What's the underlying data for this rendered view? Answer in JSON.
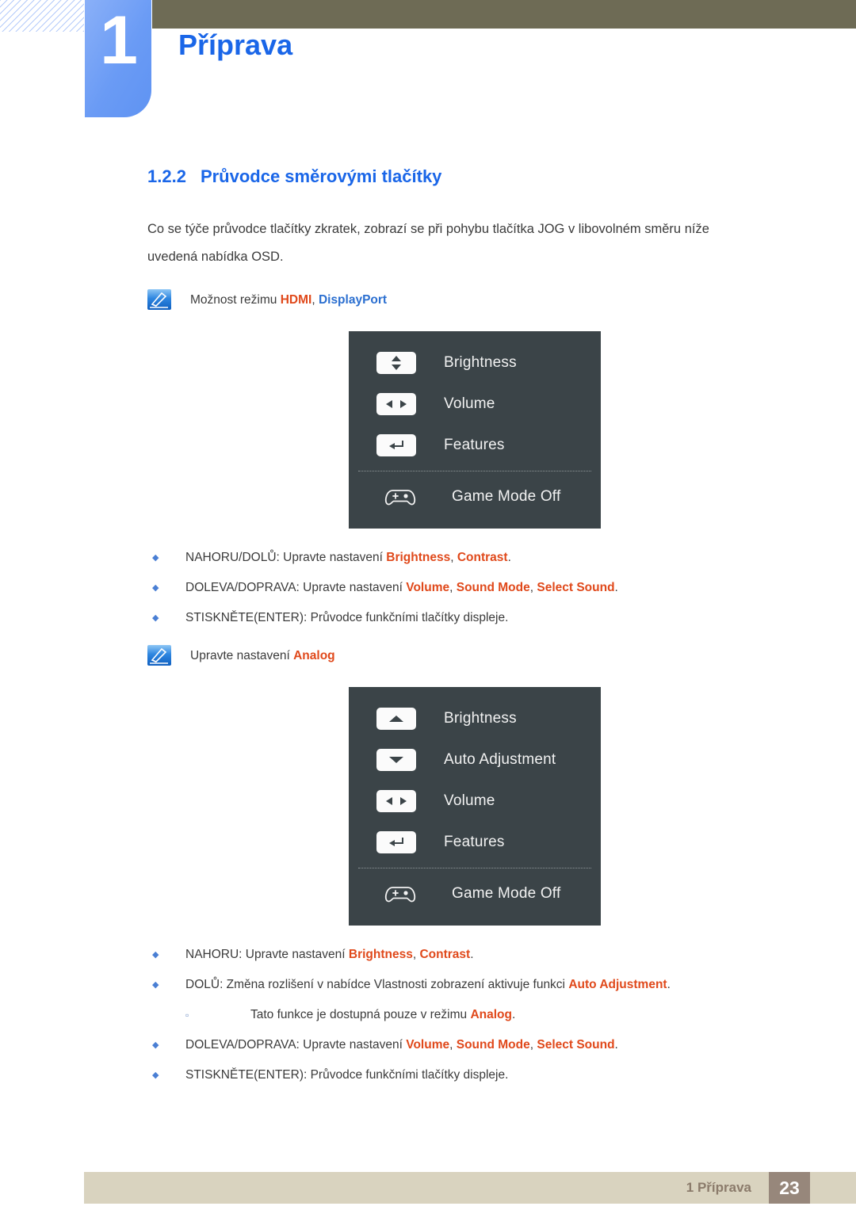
{
  "header": {
    "chapter_number": "1",
    "chapter_title": "Příprava",
    "accent_blue": "#1a66e8",
    "tab_blue": "#6a9bf5",
    "olive": "#6e6b55"
  },
  "section": {
    "number": "1.2.2",
    "title": "Průvodce směrovými tlačítky"
  },
  "intro": {
    "paragraph": "Co se týče průvodce tlačítky zkratek, zobrazí se při pohybu tlačítka JOG v libovolném směru níže uvedená nabídka OSD."
  },
  "note_one": {
    "icon": "note-pen-icon",
    "prefix": "Možnost režimu ",
    "term_hdmi": "HDMI",
    "comma": ", ",
    "term_displayport": "DisplayPort"
  },
  "osd_panel_one": {
    "background": "#3b4448",
    "rows": [
      {
        "key": "updown-arrows-icon",
        "label": "Brightness"
      },
      {
        "key": "leftright-arrows-icon",
        "label": "Volume"
      },
      {
        "key": "enter-arrow-icon",
        "label": "Features"
      }
    ],
    "game_row": {
      "key": "gamepad-icon",
      "label": "Game Mode Off"
    }
  },
  "bullets_one": [
    {
      "prefix": "NAHORU/DOLŮ: Upravte nastavení ",
      "terms": [
        "Brightness",
        "Contrast"
      ],
      "suffix": "."
    },
    {
      "prefix": "DOLEVA/DOPRAVA: Upravte nastavení ",
      "terms": [
        "Volume",
        "Sound Mode",
        "Select Sound"
      ],
      "suffix": "."
    },
    {
      "prefix": "STISKNĚTE(ENTER): Průvodce funkčními tlačítky displeje.",
      "terms": [],
      "suffix": ""
    }
  ],
  "note_two": {
    "icon": "note-pen-icon",
    "prefix": "Upravte nastavení ",
    "term_analog": "Analog"
  },
  "osd_panel_two": {
    "background": "#3b4448",
    "rows": [
      {
        "key": "up-arrow-icon",
        "label": "Brightness"
      },
      {
        "key": "down-arrow-icon",
        "label": "Auto Adjustment"
      },
      {
        "key": "leftright-arrows-icon",
        "label": "Volume"
      },
      {
        "key": "enter-arrow-icon",
        "label": "Features"
      }
    ],
    "game_row": {
      "key": "gamepad-icon",
      "label": "Game Mode Off"
    }
  },
  "bullets_two": [
    {
      "level": "top",
      "prefix": "NAHORU: Upravte nastavení ",
      "terms": [
        "Brightness",
        "Contrast"
      ],
      "suffix": "."
    },
    {
      "level": "top",
      "prefix": "DOLŮ: Změna rozlišení v nabídce Vlastnosti zobrazení aktivuje funkci ",
      "terms": [
        "Auto Adjustment"
      ],
      "suffix": "."
    },
    {
      "level": "sub",
      "prefix": "Tato funkce je dostupná pouze v režimu ",
      "terms": [
        "Analog"
      ],
      "suffix": "."
    },
    {
      "level": "top",
      "prefix": "DOLEVA/DOPRAVA: Upravte nastavení ",
      "terms": [
        "Volume",
        "Sound Mode",
        "Select Sound"
      ],
      "suffix": "."
    },
    {
      "level": "top",
      "prefix": "STISKNĚTE(ENTER): Průvodce funkčními tlačítky displeje.",
      "terms": [],
      "suffix": ""
    }
  ],
  "footer": {
    "label": "1 Příprava",
    "page_number": "23",
    "bar_color": "#d9d3bf",
    "page_box_color": "#97877b"
  }
}
